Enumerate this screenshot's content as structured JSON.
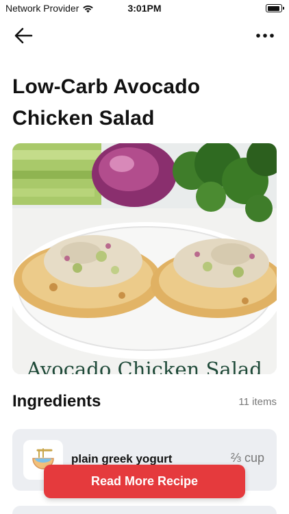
{
  "status_bar": {
    "carrier": "Network Provider",
    "time": "3:01PM",
    "wifi_icon": "wifi-icon",
    "battery_icon": "battery-icon"
  },
  "nav": {
    "back_icon": "arrow-left-icon",
    "more_icon": "more-horizontal-icon"
  },
  "recipe": {
    "title": "Low-Carb Avocado Chicken Salad",
    "image_caption": "Avocado Chicken Salad"
  },
  "ingredients": {
    "heading": "Ingredients",
    "count_label": "11 items",
    "items": [
      {
        "name": "plain greek yogurt",
        "quantity": "⅔ cup",
        "icon": "yogurt-bowl-icon"
      }
    ]
  },
  "cta": {
    "label": "Read More Recipe",
    "color": "#e53a3d"
  }
}
